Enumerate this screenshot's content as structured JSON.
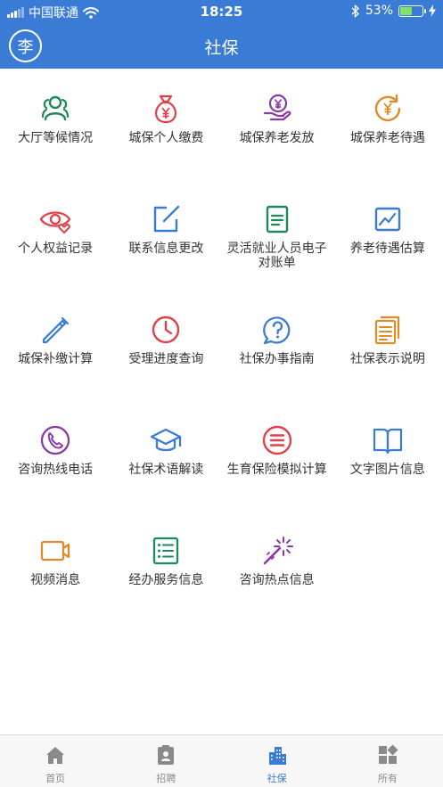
{
  "status_bar": {
    "carrier": "中国联通",
    "time": "18:25",
    "battery": "53%",
    "battery_level": 0.53
  },
  "header": {
    "avatar_text": "李",
    "title": "社保"
  },
  "services": [
    {
      "label": "大厅等候情况",
      "icon": "people-icon",
      "color": "#1e8a5a"
    },
    {
      "label": "城保个人缴费",
      "icon": "money-bag-icon",
      "color": "#e0404a"
    },
    {
      "label": "城保养老发放",
      "icon": "yuan-hand-icon",
      "color": "#8a3aa5"
    },
    {
      "label": "城保养老待遇",
      "icon": "yuan-refresh-icon",
      "color": "#e08a2a"
    },
    {
      "label": "个人权益记录",
      "icon": "eye-heart-icon",
      "color": "#e0404a"
    },
    {
      "label": "联系信息更改",
      "icon": "edit-icon",
      "color": "#3a7bd5"
    },
    {
      "label": "灵活就业人员电子对账单",
      "icon": "document-icon",
      "color": "#1e8a5a"
    },
    {
      "label": "养老待遇估算",
      "icon": "chart-icon",
      "color": "#3a7bd5"
    },
    {
      "label": "城保补缴计算",
      "icon": "pencil-icon",
      "color": "#3a7bd5"
    },
    {
      "label": "受理进度查询",
      "icon": "clock-icon",
      "color": "#e0404a"
    },
    {
      "label": "社保办事指南",
      "icon": "question-icon",
      "color": "#3a7bd5"
    },
    {
      "label": "社保表示说明",
      "icon": "file-stack-icon",
      "color": "#e08a2a"
    },
    {
      "label": "咨询热线电话",
      "icon": "phone-icon",
      "color": "#8a3aa5"
    },
    {
      "label": "社保术语解读",
      "icon": "graduation-cap-icon",
      "color": "#3a7bd5"
    },
    {
      "label": "生育保险模拟计算",
      "icon": "list-circle-icon",
      "color": "#e0404a"
    },
    {
      "label": "文字图片信息",
      "icon": "book-icon",
      "color": "#3a7bd5"
    },
    {
      "label": "视频消息",
      "icon": "video-icon",
      "color": "#e08a2a"
    },
    {
      "label": "经办服务信息",
      "icon": "list-icon",
      "color": "#1e8a5a"
    },
    {
      "label": "咨询热点信息",
      "icon": "magic-wand-icon",
      "color": "#8a3aa5"
    }
  ],
  "tabs": [
    {
      "label": "首页",
      "icon": "home-icon",
      "active": false
    },
    {
      "label": "招聘",
      "icon": "badge-icon",
      "active": false
    },
    {
      "label": "社保",
      "icon": "building-icon",
      "active": true
    },
    {
      "label": "所有",
      "icon": "apps-icon",
      "active": false
    }
  ],
  "colors": {
    "brand": "#3a7bd5",
    "tab_inactive": "#8a8a8a"
  }
}
